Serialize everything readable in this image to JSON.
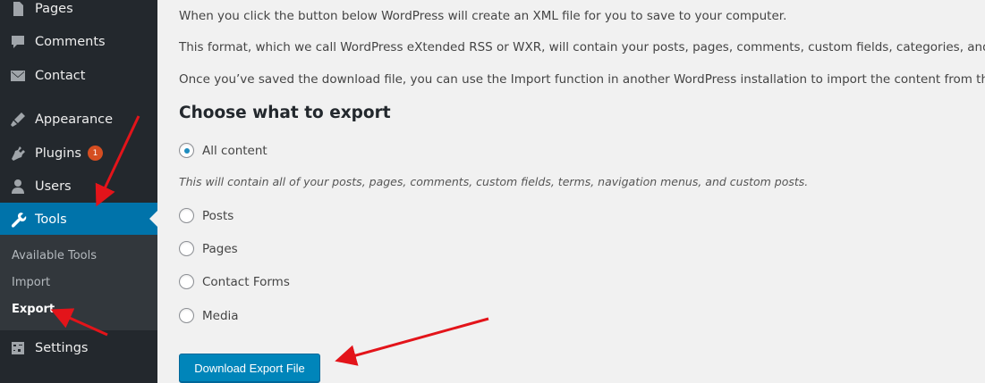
{
  "sidebar": {
    "items": [
      {
        "label": "Pages",
        "icon": "pages-icon"
      },
      {
        "label": "Comments",
        "icon": "comments-icon"
      },
      {
        "label": "Contact",
        "icon": "contact-icon"
      },
      {
        "label": "Appearance",
        "icon": "appearance-icon"
      },
      {
        "label": "Plugins",
        "icon": "plugins-icon",
        "badge": "1"
      },
      {
        "label": "Users",
        "icon": "users-icon"
      },
      {
        "label": "Tools",
        "icon": "tools-icon",
        "active": true
      },
      {
        "label": "Settings",
        "icon": "settings-icon"
      }
    ],
    "submenu": [
      {
        "label": "Available Tools"
      },
      {
        "label": "Import"
      },
      {
        "label": "Export",
        "current": true
      }
    ]
  },
  "main": {
    "paragraphs": [
      "When you click the button below WordPress will create an XML file for you to save to your computer.",
      "This format, which we call WordPress eXtended RSS or WXR, will contain your posts, pages, comments, custom fields, categories, and tags.",
      "Once you’ve saved the download file, you can use the Import function in another WordPress installation to import the content from this site."
    ],
    "heading": "Choose what to export",
    "options": [
      {
        "label": "All content",
        "checked": true
      },
      {
        "label": "Posts",
        "checked": false
      },
      {
        "label": "Pages",
        "checked": false
      },
      {
        "label": "Contact Forms",
        "checked": false
      },
      {
        "label": "Media",
        "checked": false
      }
    ],
    "all_content_description": "This will contain all of your posts, pages, comments, custom fields, terms, navigation menus, and custom posts.",
    "download_button": "Download Export File"
  },
  "colors": {
    "sidebar_bg": "#23282d",
    "submenu_bg": "#32373c",
    "active_bg": "#0073aa",
    "button_bg": "#0085ba",
    "annotation_arrow": "#e3141a",
    "badge_bg": "#d54e21"
  }
}
